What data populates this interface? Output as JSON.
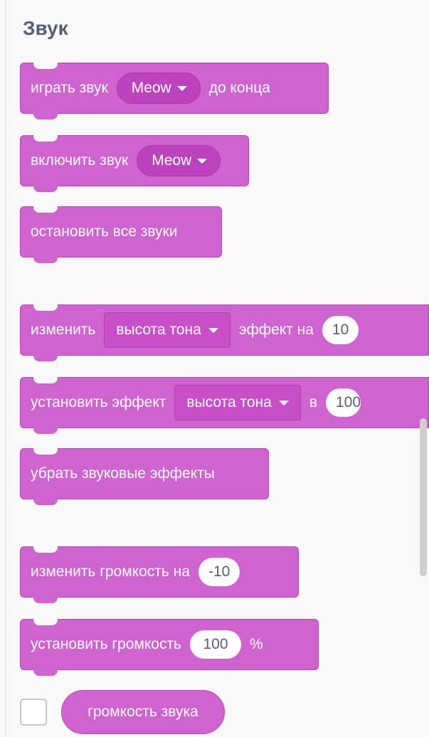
{
  "category": {
    "title": "Звук"
  },
  "blocks": {
    "play_sound_until_done": {
      "prefix": "играть звук",
      "sound": "Meow",
      "suffix": "до конца"
    },
    "start_sound": {
      "prefix": "включить звук",
      "sound": "Meow"
    },
    "stop_all_sounds": {
      "label": "остановить все звуки"
    },
    "change_effect": {
      "prefix": "изменить",
      "effect": "высота тона",
      "middle": "эффект на",
      "value": "10"
    },
    "set_effect": {
      "prefix": "установить эффект",
      "effect": "высота тона",
      "middle": "в",
      "value": "100"
    },
    "clear_effects": {
      "label": "убрать звуковые эффекты"
    },
    "change_volume": {
      "prefix": "изменить громкость на",
      "value": "-10"
    },
    "set_volume": {
      "prefix": "установить громкость",
      "value": "100",
      "suffix": "%"
    },
    "volume_reporter": {
      "label": "громкость звука",
      "checked": false
    }
  },
  "colors": {
    "block_fill": "#cf63cf",
    "block_border": "#bd42bd",
    "dropdown_fill": "#bd42bd",
    "title_text": "#575e75",
    "background": "#f9f9f9"
  }
}
